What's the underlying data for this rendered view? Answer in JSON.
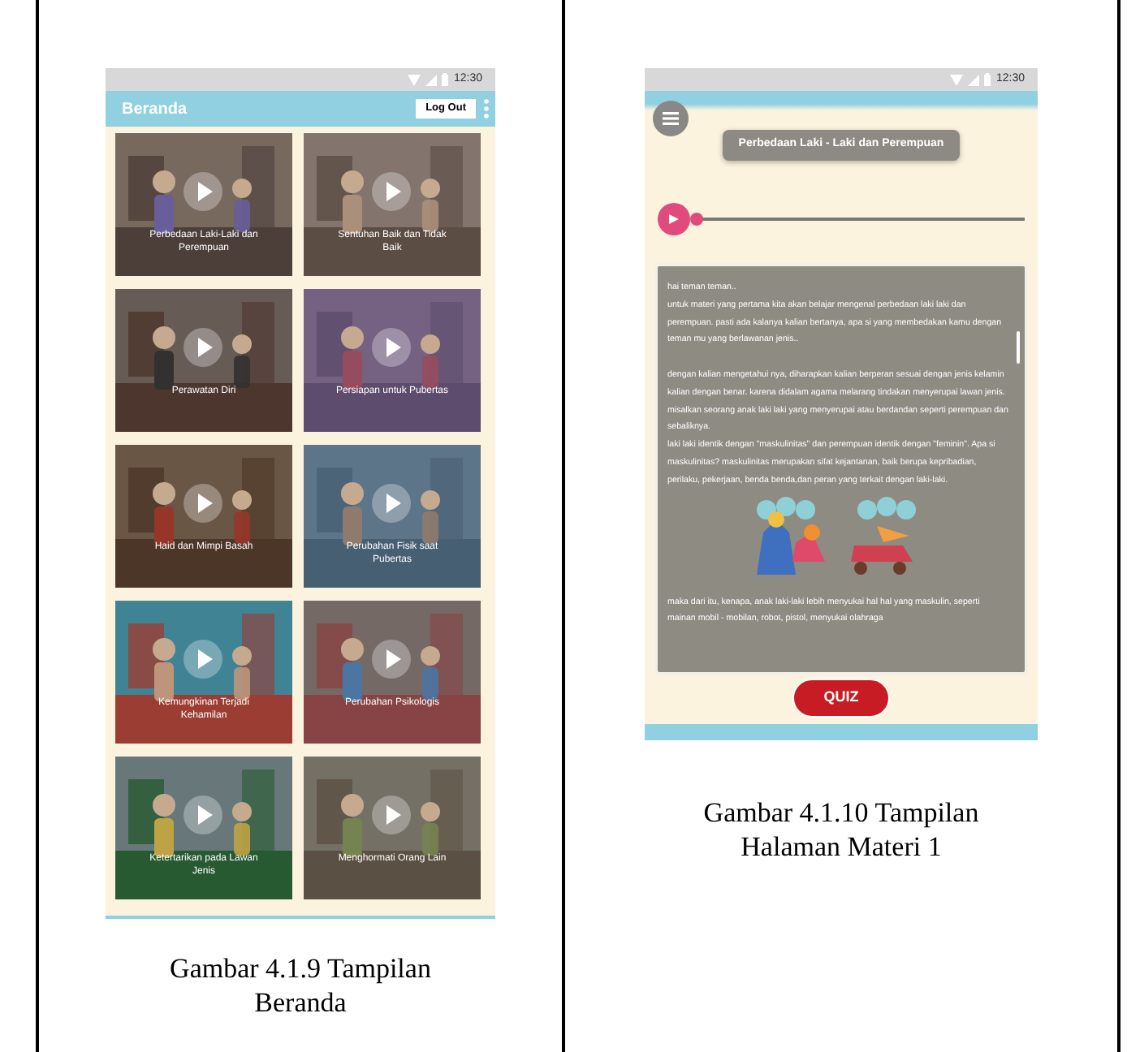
{
  "home_screen": {
    "status_time": "12:30",
    "title": "Beranda",
    "logout_button": "Log Out",
    "cards": [
      {
        "title": "Perbedaan Laki-Laki dan Perempuan"
      },
      {
        "title": "Sentuhan Baik dan Tidak Baik"
      },
      {
        "title": "Perawatan Diri"
      },
      {
        "title": "Persiapan untuk Pubertas"
      },
      {
        "title": "Haid dan Mimpi Basah"
      },
      {
        "title": "Perubahan Fisik saat Pubertas"
      },
      {
        "title": "Kemungkinan Terjadi Kehamilan"
      },
      {
        "title": "Perubahan Psikologis"
      },
      {
        "title": "Ketertarikan pada Lawan Jenis"
      },
      {
        "title": "Menghormati Orang Lain"
      }
    ]
  },
  "home_caption": "Gambar 4.1.9 Tampilan Beranda",
  "material_screen": {
    "status_time": "12:30",
    "title": "Perbedaan Laki - Laki dan Perempuan",
    "audio": {
      "level": 0
    },
    "paragraphs": [
      "hai teman teman..",
      "untuk materi yang pertama kita akan belajar mengenal perbedaan laki laki dan perempuan. pasti ada kalanya kalian bertanya, apa si yang membedakan kamu dengan teman mu yang berlawanan jenis..",
      "dengan kalian mengetahui nya, diharapkan kalian berperan sesuai dengan jenis kelamin kalian dengan benar. karena didalam agama melarang tindakan menyerupai lawan jenis. misalkan seorang anak laki laki yang menyerupai atau berdandan seperti perempuan dan sebaliknya.",
      "laki laki identik dengan \"maskulinitas\" dan perempuan identik dengan \"feminin\". Apa si maskulinitas? maskulinitas merupakan sifat kejantanan, baik berupa kepribadian, perilaku, pekerjaan, benda benda,dan peran yang terkait dengan laki-laki.",
      "maka dari itu, kenapa, anak laki-laki lebih menyukai hal hal yang maskulin, seperti mainan mobil - mobilan, robot, pistol, menyukai olahraga"
    ],
    "quiz_button": "QUIZ"
  },
  "material_caption": "Gambar 4.1.10 Tampilan Halaman Materi 1"
}
